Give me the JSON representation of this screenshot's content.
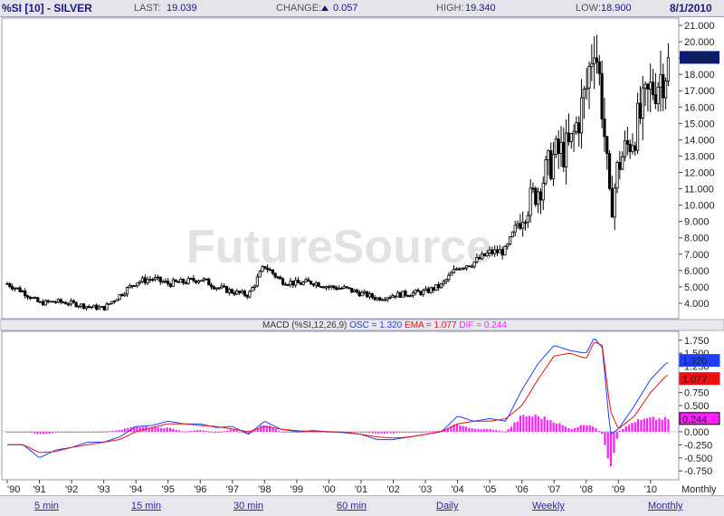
{
  "header": {
    "symbol": "%SI [10] - SILVER",
    "last_label": "LAST:",
    "last_value": "19.039",
    "change_label": "CHANGE:",
    "change_value": "0.057",
    "high_label": "HIGH:",
    "high_value": "19.340",
    "low_label": "LOW:",
    "low_value": "18.900",
    "date": "8/1/2010"
  },
  "watermark": "FutureSource",
  "price_panel": {
    "y_ticks": [
      "21.000",
      "20.000",
      "19.000",
      "18.000",
      "17.000",
      "16.000",
      "15.000",
      "14.000",
      "13.000",
      "12.000",
      "11.000",
      "10.000",
      "9.000",
      "8.000",
      "7.000",
      "6.000",
      "5.000",
      "4.000"
    ],
    "last_tag": "19.039"
  },
  "macd_panel": {
    "title": "MACD (%SI,12,26,9)",
    "osc_text": "OSC = 1.320",
    "ema_text": "EMA = 1.077",
    "dif_text": "DIF = 0.244",
    "y_ticks": [
      "1.750",
      "1.500",
      "1.250",
      "1.000",
      "0.750",
      "0.500",
      "0.250",
      "0.000",
      "-0.250",
      "-0.500",
      "-0.750"
    ],
    "osc_tag": "1.320",
    "ema_tag": "1.077",
    "dif_tag": "0.244"
  },
  "x_axis": {
    "labels": [
      "'90",
      "'91",
      "'92",
      "'93",
      "'94",
      "'95",
      "'96",
      "'97",
      "'98",
      "'99",
      "'00",
      "'01",
      "'02",
      "'03",
      "'04",
      "'05",
      "'06",
      "'07",
      "'08",
      "'09",
      "'10"
    ],
    "period_label": "Monthly"
  },
  "timeframes": [
    "5 min",
    "15 min",
    "30 min",
    "60 min",
    "Daily",
    "Weekly",
    "Monthly"
  ],
  "colors": {
    "candle": "#000000",
    "osc": "#1f3fff",
    "ema": "#ee1010",
    "dif": "#ff20ff",
    "tag_bg": "#0a1a7a"
  },
  "chart_data": [
    {
      "type": "candlestick",
      "title": "%SI [10] - SILVER",
      "period": "Monthly",
      "x": [
        1990.0,
        1990.5,
        1991.0,
        1991.5,
        1992.0,
        1992.5,
        1993.0,
        1993.5,
        1994.0,
        1994.5,
        1995.0,
        1995.5,
        1996.0,
        1996.5,
        1997.0,
        1997.5,
        1998.0,
        1998.5,
        1999.0,
        1999.5,
        2000.0,
        2000.5,
        2001.0,
        2001.5,
        2002.0,
        2002.5,
        2003.0,
        2003.5,
        2004.0,
        2004.5,
        2005.0,
        2005.5,
        2006.0,
        2006.5,
        2007.0,
        2007.5,
        2008.0,
        2008.25,
        2008.5,
        2008.75,
        2009.0,
        2009.5,
        2010.0,
        2010.5
      ],
      "close": [
        5.2,
        4.7,
        4.0,
        4.1,
        4.0,
        3.8,
        3.7,
        4.5,
        5.3,
        5.5,
        5.2,
        5.3,
        5.5,
        5.0,
        4.7,
        4.5,
        6.3,
        5.4,
        5.2,
        5.3,
        5.0,
        4.9,
        4.6,
        4.3,
        4.5,
        4.6,
        4.7,
        5.1,
        6.2,
        6.5,
        7.1,
        7.2,
        9.5,
        11.0,
        13.0,
        13.5,
        17.0,
        20.5,
        16.0,
        9.5,
        12.5,
        14.5,
        17.0,
        18.5
      ],
      "ylim": [
        3.5,
        21.0
      ],
      "last": 19.039
    },
    {
      "type": "line",
      "title": "MACD (%SI,12,26,9)",
      "x": [
        1990.0,
        1990.5,
        1991.0,
        1991.5,
        1992.0,
        1992.5,
        1993.0,
        1993.5,
        1994.0,
        1994.5,
        1995.0,
        1995.5,
        1996.0,
        1996.5,
        1997.0,
        1997.5,
        1998.0,
        1998.5,
        1999.0,
        1999.5,
        2000.0,
        2000.5,
        2001.0,
        2001.5,
        2002.0,
        2002.5,
        2003.0,
        2003.5,
        2004.0,
        2004.5,
        2005.0,
        2005.5,
        2006.0,
        2006.5,
        2007.0,
        2007.5,
        2008.0,
        2008.25,
        2008.5,
        2008.75,
        2009.0,
        2009.5,
        2010.0,
        2010.5
      ],
      "series": [
        {
          "name": "OSC",
          "values": [
            -0.25,
            -0.25,
            -0.5,
            -0.35,
            -0.3,
            -0.2,
            -0.2,
            -0.1,
            0.1,
            0.12,
            0.2,
            0.15,
            0.15,
            0.08,
            0.1,
            -0.05,
            0.2,
            0.05,
            0.0,
            0.02,
            0.0,
            -0.02,
            -0.05,
            -0.15,
            -0.15,
            -0.1,
            -0.05,
            0.0,
            0.3,
            0.2,
            0.25,
            0.2,
            0.8,
            1.3,
            1.65,
            1.55,
            1.5,
            1.8,
            1.6,
            -0.05,
            0.05,
            0.5,
            1.0,
            1.32
          ]
        },
        {
          "name": "EMA",
          "values": [
            -0.25,
            -0.25,
            -0.4,
            -0.38,
            -0.3,
            -0.25,
            -0.2,
            -0.15,
            0.0,
            0.08,
            0.15,
            0.15,
            0.12,
            0.1,
            0.05,
            0.0,
            0.1,
            0.05,
            0.02,
            0.0,
            0.0,
            -0.01,
            -0.05,
            -0.1,
            -0.12,
            -0.1,
            -0.05,
            0.0,
            0.15,
            0.2,
            0.2,
            0.25,
            0.5,
            1.0,
            1.45,
            1.5,
            1.4,
            1.72,
            1.65,
            0.4,
            0.05,
            0.3,
            0.75,
            1.077
          ]
        },
        {
          "name": "DIF",
          "values": [
            0.0,
            0.0,
            -0.05,
            -0.02,
            0.0,
            0.0,
            0.0,
            0.03,
            0.1,
            0.08,
            0.08,
            0.0,
            0.04,
            -0.03,
            0.05,
            -0.05,
            0.15,
            0.0,
            -0.02,
            0.02,
            0.0,
            0.0,
            0.0,
            -0.04,
            -0.03,
            0.0,
            0.0,
            0.02,
            0.15,
            0.05,
            0.05,
            0.0,
            0.3,
            0.3,
            0.2,
            0.05,
            0.15,
            0.1,
            -0.05,
            -0.8,
            0.0,
            0.2,
            0.25,
            0.244
          ]
        }
      ],
      "ylim": [
        -0.85,
        1.85
      ]
    }
  ]
}
